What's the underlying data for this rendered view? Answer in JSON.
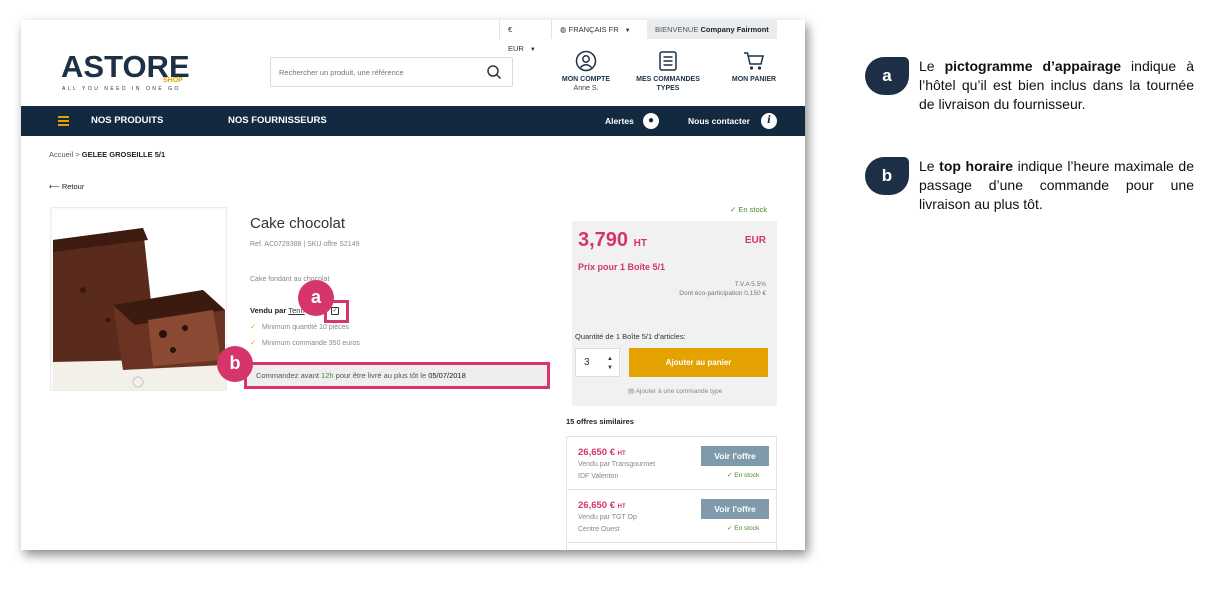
{
  "util": {
    "currency": "€ EUR",
    "language": "FRANÇAIS FR",
    "welcome_label": "BIENVENUE",
    "welcome_company": "Company Fairmont"
  },
  "logo": {
    "main": "ASTORE",
    "sub": "SHOP",
    "tagline": "ALL YOU NEED IN ONE GO"
  },
  "search": {
    "placeholder": "Rechercher un produit, une référence"
  },
  "header": {
    "account_label": "MON COMPTE",
    "account_user": "Anne S.",
    "orders_label_1": "MES COMMANDES",
    "orders_label_2": "TYPES",
    "cart_label": "MON PANIER"
  },
  "nav": {
    "products": "NOS PRODUITS",
    "suppliers": "NOS FOURNISSEURS",
    "alerts": "Alertes",
    "contact": "Nous contacter"
  },
  "breadcrumb": {
    "home": "Accueil",
    "sep": ">",
    "current": "GELEE GROSEILLE 5/1"
  },
  "back": "Retour",
  "product": {
    "title": "Cake chocolat",
    "ref": "Ref. AC0729388 | SKU offre S2149",
    "desc": "Cake fondant au chocolat",
    "sold_by_label": "Vendu par",
    "sold_by": "Tenn",
    "min_qty": "Minimum quantité 10 pièces",
    "min_order": "Minimum commande 350 euros",
    "order_prefix": "Commandez avant",
    "order_hour": "12h",
    "order_mid": "pour être livré au plus tôt le",
    "order_date": "05/07/2018"
  },
  "callouts": {
    "a": "a",
    "b": "b"
  },
  "panel": {
    "stock": "En stock",
    "price": "3,790",
    "price_unit": "HT",
    "currency": "EUR",
    "per": "Prix pour 1 Boîte 5/1",
    "tva": "T.V.A 5.5%",
    "eco": "Dont éco-participation 0,150 €",
    "qty_label": "Quantité de 1 Boîte 5/1 d'articles:",
    "qty_value": "3",
    "add_button": "Ajouter au panier",
    "add_type": "Ajouter à une commande type"
  },
  "similar": {
    "title": "15 offres similaires",
    "offers": [
      {
        "price": "26,650 €",
        "unit": "HT",
        "vendor": "Vendu par Transgourmet",
        "location": "IDF Valenton",
        "button": "Voir l'offre",
        "stock": "En stock"
      },
      {
        "price": "26,650 €",
        "unit": "HT",
        "vendor": "Vendu par TGT Op",
        "location": "Centre Ouest",
        "button": "Voir l'offre",
        "stock": "En stock"
      }
    ]
  },
  "legend": {
    "a_letter": "a",
    "a_text_1": "Le ",
    "a_text_bold": "pictogramme d’appairage",
    "a_text_2": " indique à l’hôtel qu’il est bien inclus dans la tournée de livraison du fournisseur.",
    "b_letter": "b",
    "b_text_1": "Le ",
    "b_text_bold": "top horaire",
    "b_text_2": " indique l’heure maximale de passage d’une commande pour une livraison au plus tôt."
  },
  "colors": {
    "brand_navy": "#12293f",
    "accent_yellow": "#e3a200",
    "price_pink": "#d6356b",
    "stock_green": "#4b8a2a",
    "legend_navy": "#1d2f47"
  }
}
